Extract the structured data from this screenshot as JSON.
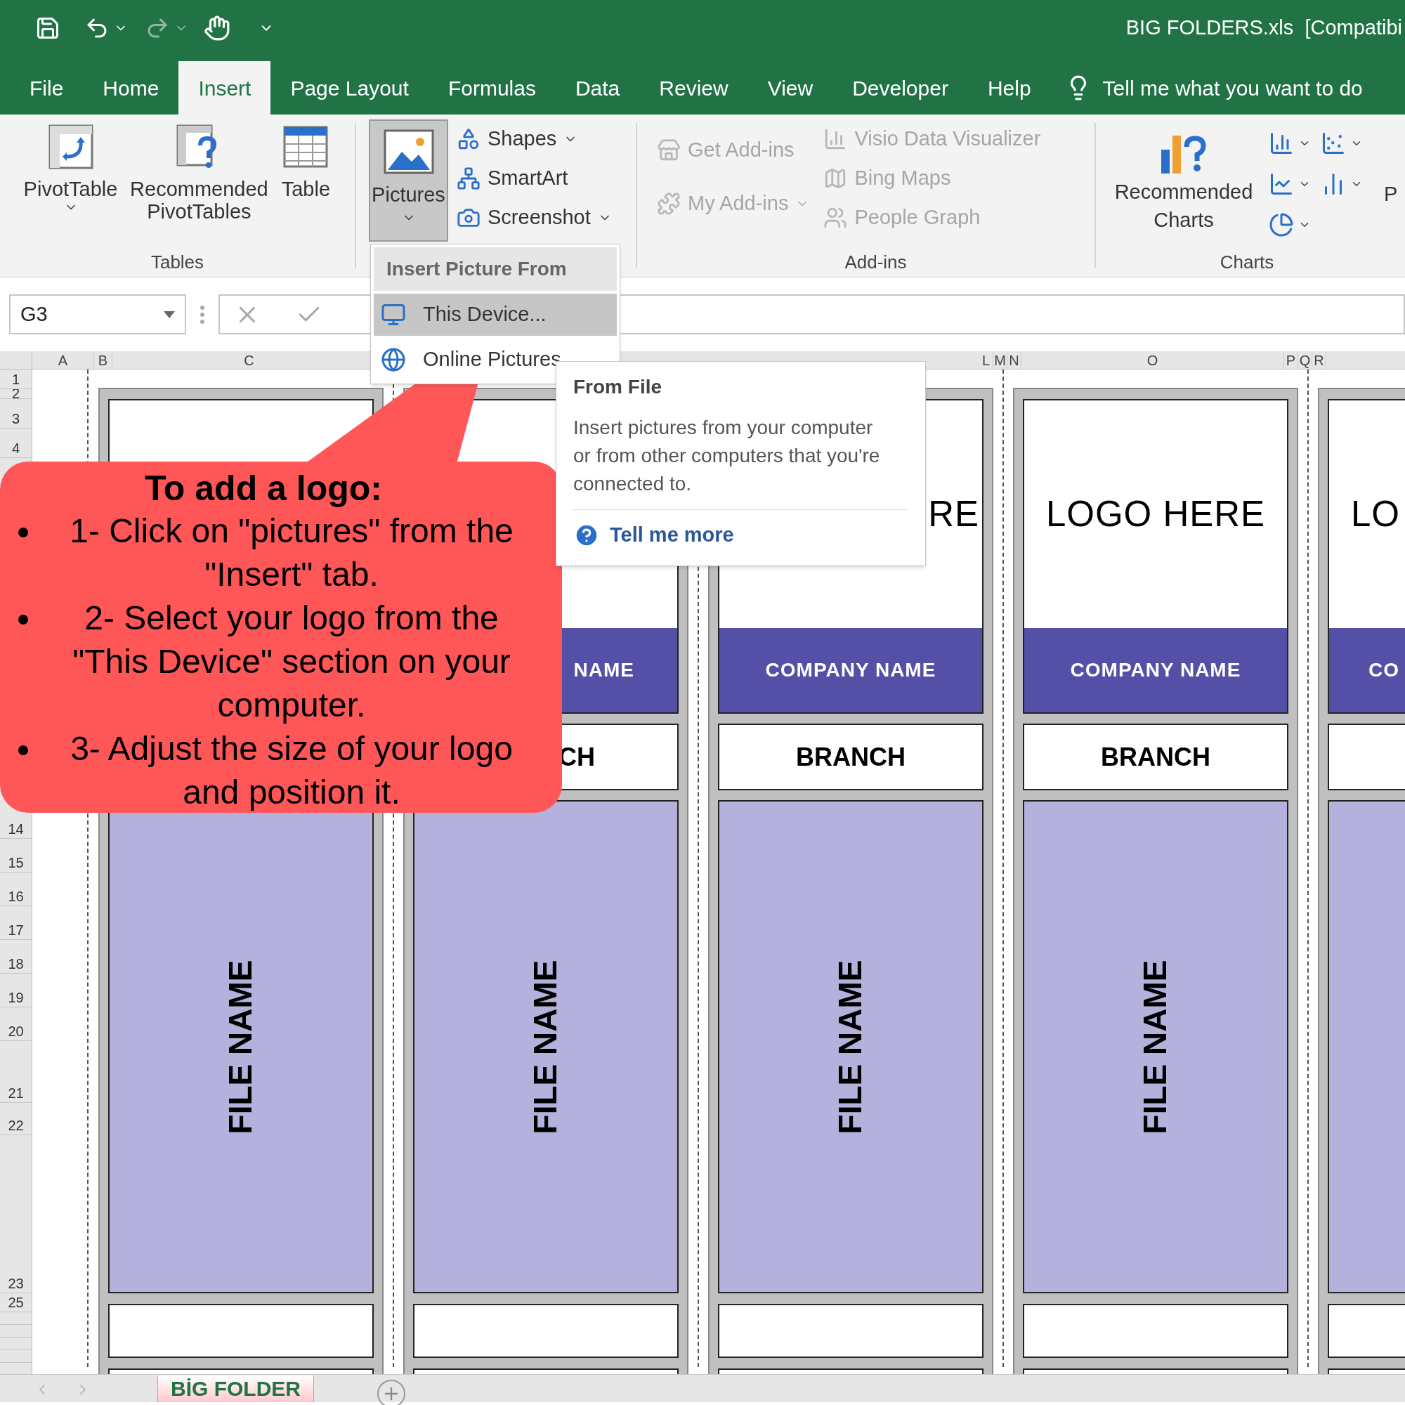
{
  "title_bar": {
    "title": "BIG FOLDERS.xls  [Compatibi"
  },
  "tabs": [
    {
      "label": "File",
      "selected": false
    },
    {
      "label": "Home",
      "selected": false
    },
    {
      "label": "Insert",
      "selected": true
    },
    {
      "label": "Page Layout",
      "selected": false
    },
    {
      "label": "Formulas",
      "selected": false
    },
    {
      "label": "Data",
      "selected": false
    },
    {
      "label": "Review",
      "selected": false
    },
    {
      "label": "View",
      "selected": false
    },
    {
      "label": "Developer",
      "selected": false
    },
    {
      "label": "Help",
      "selected": false
    }
  ],
  "tell_me": {
    "placeholder": "Tell me what you want to do"
  },
  "ribbon": {
    "tables": {
      "label": "Tables",
      "buttons": [
        {
          "label": "PivotTable",
          "caret": true,
          "disabled": false
        },
        {
          "label": "Recommended PivotTables",
          "caret": false,
          "disabled": false
        },
        {
          "label": "Table",
          "caret": false,
          "disabled": false
        }
      ]
    },
    "illustrations": {
      "pictures": {
        "label": "Pictures",
        "caret": true,
        "selected": true
      },
      "buttons": [
        {
          "label": "Shapes",
          "caret": true,
          "disabled": false
        },
        {
          "label": "SmartArt",
          "caret": false,
          "disabled": false
        },
        {
          "label": "Screenshot",
          "caret": true,
          "disabled": false
        }
      ]
    },
    "addins": {
      "label": "Add-ins",
      "buttons": [
        {
          "label": "Get Add-ins",
          "caret": false,
          "disabled": true
        },
        {
          "label": "My Add-ins",
          "caret": true,
          "disabled": true
        },
        {
          "label": "Visio Data Visualizer",
          "caret": false,
          "disabled": true
        },
        {
          "label": "Bing Maps",
          "caret": false,
          "disabled": true
        },
        {
          "label": "People Graph",
          "caret": false,
          "disabled": true
        }
      ]
    },
    "charts": {
      "label": "Charts",
      "recommended": "Recommended Charts"
    },
    "cut_label": "P"
  },
  "formula_bar": {
    "name_box": "G3"
  },
  "column_headers": [
    {
      "label": "A"
    },
    {
      "label": "B"
    },
    {
      "label": "C"
    },
    {
      "label": "L"
    },
    {
      "label": "M"
    },
    {
      "label": "N"
    },
    {
      "label": "O"
    },
    {
      "label": "P"
    },
    {
      "label": "Q"
    },
    {
      "label": "R"
    }
  ],
  "row_headers": [
    {
      "label": "1"
    },
    {
      "label": "2"
    },
    {
      "label": "3"
    },
    {
      "label": "4"
    },
    {
      "label": "14"
    },
    {
      "label": "15"
    },
    {
      "label": "16"
    },
    {
      "label": "17"
    },
    {
      "label": "18"
    },
    {
      "label": "19"
    },
    {
      "label": "20"
    },
    {
      "label": "21"
    },
    {
      "label": "22"
    },
    {
      "label": "23"
    },
    {
      "label": "25"
    }
  ],
  "folders": [
    {
      "file_name": "FILE NAME"
    },
    {
      "company": "NAME",
      "branch": "CH",
      "file_name": "FILE NAME"
    },
    {
      "logo": "RE",
      "company": "COMPANY NAME",
      "branch": "BRANCH",
      "file_name": "FILE NAME"
    },
    {
      "logo": "LOGO HERE",
      "company": "COMPANY NAME",
      "branch": "BRANCH",
      "file_name": "FILE NAME"
    },
    {
      "logo": "LO",
      "company": "CO"
    }
  ],
  "picture_menu": {
    "header": "Insert Picture From",
    "items": [
      {
        "label": "This Device...",
        "selected": true
      },
      {
        "label": "Online Pictures",
        "selected": false
      }
    ]
  },
  "tooltip": {
    "title": "From File",
    "body": "Insert pictures from your computer or from other computers that you're connected to.",
    "link": "Tell me more"
  },
  "callout": {
    "title": "To add a logo:",
    "steps": [
      "1- Click on \"pictures\" from the \"Insert\" tab.",
      "2- Select your logo from the \"This Device\" section on your computer.",
      "3- Adjust the size of your logo and position it."
    ]
  },
  "sheet_tabs": [
    {
      "label": "BİG FOLDER",
      "selected": true
    }
  ]
}
